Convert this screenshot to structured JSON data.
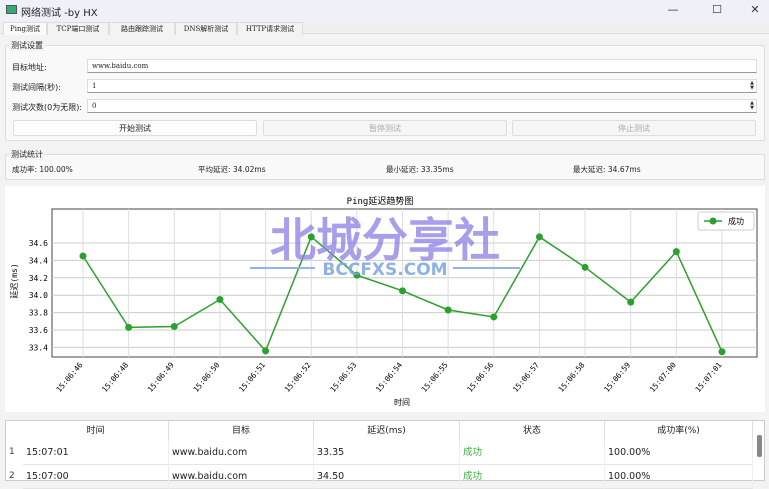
{
  "window": {
    "title": "网络测试 -by HX",
    "minimize": "—",
    "maximize": "☐",
    "close": "✕"
  },
  "tabs": [
    "Ping测试",
    "TCP端口测试",
    "路由跟踪测试",
    "DNS解析测试",
    "HTTP请求测试"
  ],
  "settings": {
    "group_title": "测试设置",
    "target_label": "目标地址:",
    "target_value": "www.baidu.com",
    "interval_label": "测试间隔(秒):",
    "interval_value": "1",
    "count_label": "测试次数(0为无限):",
    "count_value": "0",
    "start": "开始测试",
    "pause": "暂停测试",
    "stop": "停止测试"
  },
  "stats": {
    "group_title": "测试统计",
    "success_rate": "成功率: 100.00%",
    "avg": "平均延迟: 34.02ms",
    "min": "最小延迟: 33.35ms",
    "max": "最大延迟: 34.67ms"
  },
  "watermark": {
    "cn": "北城分享社",
    "en": "BCCFXS.COM"
  },
  "chart_data": {
    "type": "line",
    "title": "Ping延迟趋势图",
    "xlabel": "时间",
    "ylabel": "延迟(ms)",
    "categories": [
      "15:06:46",
      "15:06:48",
      "15:06:49",
      "15:06:50",
      "15:06:51",
      "15:06:52",
      "15:06:53",
      "15:06:54",
      "15:06:55",
      "15:06:56",
      "15:06:57",
      "15:06:58",
      "15:06:59",
      "15:07:00",
      "15:07:01"
    ],
    "series": [
      {
        "name": "成功",
        "color": "#2ca02c",
        "values": [
          34.45,
          33.63,
          33.64,
          33.95,
          33.36,
          34.67,
          34.23,
          34.05,
          33.83,
          33.75,
          34.67,
          34.32,
          33.92,
          34.5,
          33.35
        ]
      }
    ],
    "yticks": [
      "33.4",
      "33.6",
      "33.8",
      "34.0",
      "34.2",
      "34.4",
      "34.6"
    ],
    "ylim": [
      33.29,
      34.99
    ],
    "grid": true,
    "legend": "top-right"
  },
  "table": {
    "headers": [
      "时间",
      "目标",
      "延迟(ms)",
      "状态",
      "成功率(%)"
    ],
    "rows": [
      {
        "n": "1",
        "cells": [
          "15:07:01",
          "www.baidu.com",
          "33.35",
          "成功",
          "100.00%"
        ]
      },
      {
        "n": "2",
        "cells": [
          "15:07:00",
          "www.baidu.com",
          "34.50",
          "成功",
          "100.00%"
        ]
      }
    ],
    "status_color": "#3cb043"
  }
}
